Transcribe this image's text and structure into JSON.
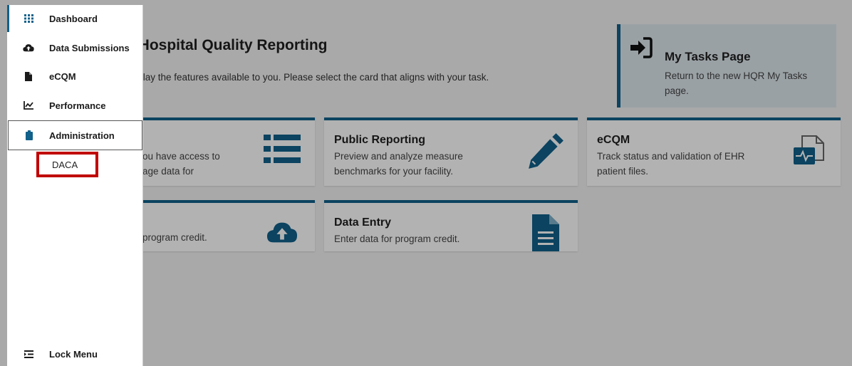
{
  "sidebar": {
    "items": [
      {
        "label": "Dashboard",
        "icon": "grid-icon"
      },
      {
        "label": "Data Submissions",
        "icon": "cloud-upload-icon"
      },
      {
        "label": "eCQM",
        "icon": "document-icon"
      },
      {
        "label": "Performance",
        "icon": "chart-icon"
      },
      {
        "label": "Administration",
        "icon": "clipboard-icon"
      }
    ],
    "sub_item": {
      "label": "DACA"
    },
    "lock_menu": {
      "label": "Lock Menu",
      "icon": "menu-collapse-icon"
    }
  },
  "main": {
    "title": "o Hospital Quality Reporting",
    "subtitle": "display the features available to you. Please select the card that aligns with your task.",
    "tasks_card": {
      "title": "My Tasks Page",
      "description": "Return to the new HQR My Tasks page.",
      "icon": "sign-in-icon"
    },
    "cards": [
      {
        "title": "",
        "description": "ou have access to age data for",
        "icon": "list-icon"
      },
      {
        "title": "Public Reporting",
        "description": "Preview and analyze measure benchmarks for your facility.",
        "icon": "pencil-icon"
      },
      {
        "title": "eCQM",
        "description": "Track status and validation of EHR patient files.",
        "icon": "ehr-file-icon"
      },
      {
        "title": "",
        "description": "program credit.",
        "icon": "cloud-upload-icon"
      },
      {
        "title": "Data Entry",
        "description": "Enter data for program credit.",
        "icon": "file-text-icon"
      }
    ]
  },
  "colors": {
    "accent": "#11618a",
    "highlight_box": "#c00000",
    "overlay": "#000000"
  }
}
